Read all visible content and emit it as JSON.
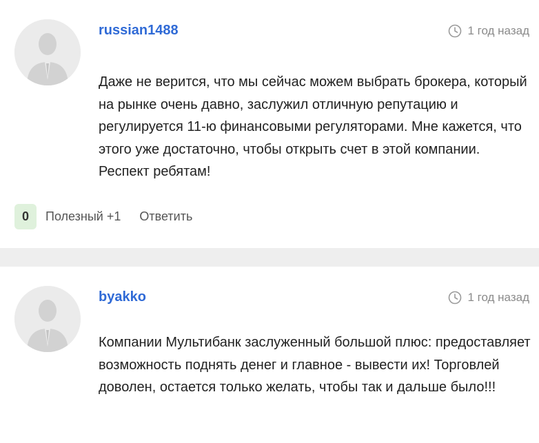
{
  "comments": [
    {
      "username": "russian1488",
      "time": "1 год назад",
      "text": "Даже не верится, что мы сейчас можем выбрать брокера, который на рынке очень давно, заслужил отличную репутацию и регулируется 11-ю финансовыми регуляторами. Мне кажется, что этого уже достаточно, чтобы открыть счет в этой компании. Респект ребятам!",
      "score": "0",
      "useful_label": "Полезный +1",
      "reply_label": "Ответить"
    },
    {
      "username": "byakko",
      "time": "1 год назад",
      "text": "Компании Мультибанк заслуженный большой плюс: предоставляет возможность поднять денег и главное - вывести их! Торговлей доволен, остается только желать, чтобы так и дальше было!!!"
    }
  ],
  "icons": {
    "avatar": "user-silhouette-icon",
    "time": "clock-icon"
  },
  "colors": {
    "username": "#2f6ad6",
    "vote_bg": "#dff1dc",
    "divider": "#eeeeee"
  }
}
